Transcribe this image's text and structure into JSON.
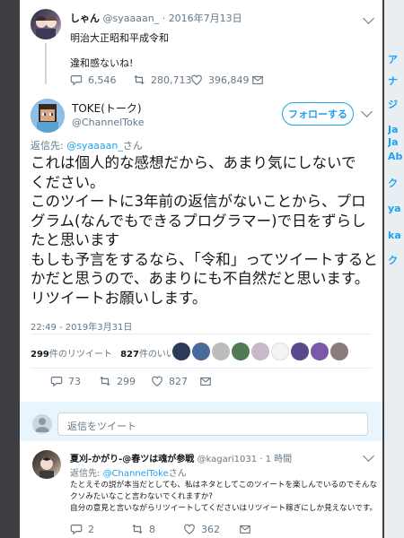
{
  "background_sidebar": [
    "ア",
    "ナ",
    "ジ",
    "Ja",
    "Ja",
    "Ab",
    "ク",
    "ya",
    "ka",
    "ク"
  ],
  "prior_tweet": {
    "user_name": "しゃん",
    "handle": "@syaaaan_",
    "date": "2016年7月13日",
    "text_line1": "明治大正昭和平成令和",
    "text_line2": "違和感ないね!",
    "replies": "6,546",
    "retweets": "280,713",
    "likes": "396,849"
  },
  "main_tweet": {
    "user_name": "TOKE(トーク)",
    "handle": "@ChannelToke",
    "follow_label": "フォローする",
    "replying_to_prefix": "返信先: ",
    "replying_to_handle": "@syaaaan_",
    "replying_to_suffix": "さん",
    "text_lines": [
      "これは個人的な感想だから、あまり気にしないで",
      "ください。",
      "このツイートに3年前の返信がないことから、プロ",
      "グラム(なんでもできるプログラマー)で日をずらし",
      "たと思います",
      "もしも予言をするなら、「令和」ってツイートすると",
      "かだと思うので、あまりにも不自然だと思います。",
      "リツイートお願いします。"
    ],
    "timestamp": "22:49 - 2019年3月31日",
    "retweet_count": "299",
    "retweet_label": "件のリツイート",
    "like_count": "827",
    "like_label": "件のいいね",
    "replies": "73",
    "retweets": "299",
    "likes": "827"
  },
  "reply_box": {
    "placeholder": "返信をツイート"
  },
  "reply_tweet": {
    "user_name": "夏刈-かがり-@春ツは魂が参戦",
    "handle": "@kagari1031",
    "time": "1 時間",
    "replying_to_prefix": "返信先: ",
    "replying_to_handle": "@ChannelToke",
    "replying_to_suffix": "さん",
    "text_lines": [
      "たとえその説が本当だとしても、私はネタとしてこのツイートを楽しんでいるのでそんな",
      "クソみたいなこと言わないでくれますか?",
      "自分の意見と言いながらリツイートしてくださいはリツイート稼ぎにしか見えないです。"
    ],
    "replies": "2",
    "retweets": "8",
    "likes": "362"
  },
  "colors": {
    "accent": "#1da1f2",
    "muted": "#657786",
    "overlay": "#3c3e41"
  }
}
